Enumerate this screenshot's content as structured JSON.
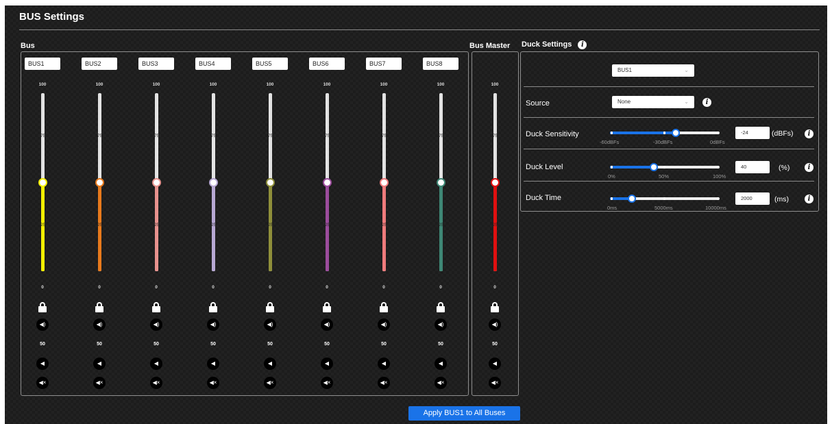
{
  "page": {
    "title": "BUS Settings"
  },
  "bus": {
    "label": "Bus",
    "scale": [
      "100",
      "75",
      "25",
      "0"
    ],
    "secondary_value": "50",
    "channels": [
      {
        "name": "BUS1",
        "color": "#f5f000",
        "level": 0.5
      },
      {
        "name": "BUS2",
        "color": "#e87a1c",
        "level": 0.5
      },
      {
        "name": "BUS3",
        "color": "#e8928e",
        "level": 0.5
      },
      {
        "name": "BUS4",
        "color": "#b7a8d3",
        "level": 0.5
      },
      {
        "name": "BUS5",
        "color": "#8f8f3a",
        "level": 0.5
      },
      {
        "name": "BUS6",
        "color": "#9b4c9c",
        "level": 0.5
      },
      {
        "name": "BUS7",
        "color": "#ef7b7c",
        "level": 0.5
      },
      {
        "name": "BUS8",
        "color": "#3e8775",
        "level": 0.5
      }
    ]
  },
  "master": {
    "label": "Bus Master",
    "color": "#e01010",
    "level": 0.5,
    "scale": [
      "100",
      "75",
      "25",
      "0"
    ],
    "secondary_value": "50"
  },
  "duck": {
    "label": "Duck Settings",
    "bus_select": "BUS1",
    "source_label": "Source",
    "source_value": "None",
    "sensitivity": {
      "label": "Duck Sensitivity",
      "value": "-24",
      "unit": "(dBFs)",
      "fraction": 0.6,
      "scale": [
        "-60dBFs",
        "-30dBFs",
        "0dBFs"
      ]
    },
    "level": {
      "label": "Duck Level",
      "value": "40",
      "unit": "(%)",
      "fraction": 0.4,
      "scale": [
        "0%",
        "50%",
        "100%"
      ]
    },
    "time": {
      "label": "Duck Time",
      "value": "2000",
      "unit": "(ms)",
      "fraction": 0.2,
      "scale": [
        "0ms",
        "5000ms",
        "10000ms"
      ]
    }
  },
  "apply_button": "Apply BUS1 to All Buses",
  "icons": {
    "info": "i",
    "volume_up": "◀)",
    "volume_down": "◀",
    "mute": "◀×",
    "chevron": "⌄"
  }
}
